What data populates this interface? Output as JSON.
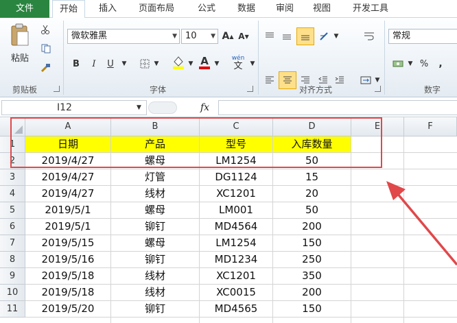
{
  "tabs": [
    "文件",
    "开始",
    "插入",
    "页面布局",
    "公式",
    "数据",
    "审阅",
    "视图",
    "开发工具"
  ],
  "ribbon": {
    "clipboard": {
      "paste_label": "粘贴",
      "group_label": "剪贴板"
    },
    "font": {
      "font_name": "微软雅黑",
      "font_size": "10",
      "group_label": "字体",
      "bold": "B",
      "italic": "I",
      "underline": "U",
      "grow": "A",
      "shrink": "A",
      "color_a": "A",
      "wen": "wén",
      "wen_char": "文"
    },
    "alignment": {
      "group_label": "对齐方式"
    },
    "number": {
      "format": "常规",
      "percent": "%",
      "comma": ",",
      "group_label": "数字"
    }
  },
  "formula_bar": {
    "name_box": "I12",
    "fx": "fx"
  },
  "sheet": {
    "columns": [
      "A",
      "B",
      "C",
      "D",
      "E",
      "F"
    ],
    "rows": [
      "1",
      "2",
      "3",
      "4",
      "5",
      "6",
      "7",
      "8",
      "9",
      "10",
      "11"
    ],
    "header": [
      "日期",
      "产品",
      "型号",
      "入库数量"
    ],
    "data": [
      [
        "2019/4/27",
        "螺母",
        "LM1254",
        "50"
      ],
      [
        "2019/4/27",
        "灯管",
        "DG1124",
        "15"
      ],
      [
        "2019/4/27",
        "线材",
        "XC1201",
        "20"
      ],
      [
        "2019/5/1",
        "螺母",
        "LM001",
        "50"
      ],
      [
        "2019/5/1",
        "铆钉",
        "MD4564",
        "200"
      ],
      [
        "2019/5/15",
        "螺母",
        "LM1254",
        "150"
      ],
      [
        "2019/5/16",
        "铆钉",
        "MD1234",
        "250"
      ],
      [
        "2019/5/18",
        "线材",
        "XC1201",
        "350"
      ],
      [
        "2019/5/18",
        "线材",
        "XC0015",
        "200"
      ],
      [
        "2019/5/20",
        "铆钉",
        "MD4565",
        "150"
      ]
    ]
  },
  "colors": {
    "file_tab": "#2a8540",
    "header_fill": "#ffff00",
    "annotation": "#e0484a"
  }
}
